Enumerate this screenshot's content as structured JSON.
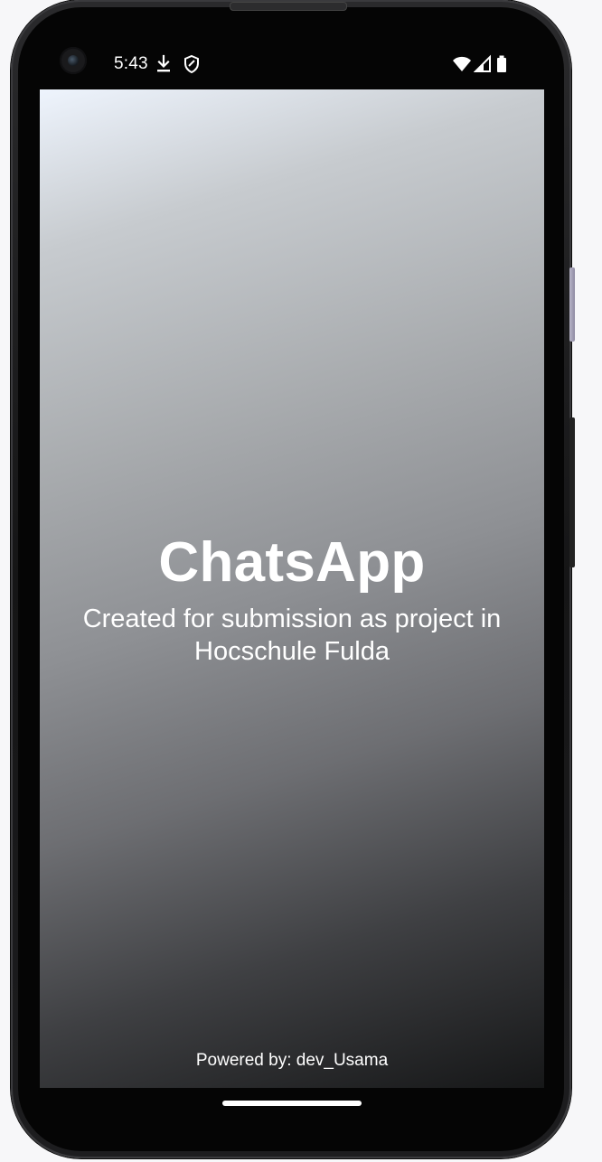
{
  "status_bar": {
    "time": "5:43",
    "icons": {
      "download": "download-icon",
      "shield": "shield-icon",
      "wifi": "wifi-icon",
      "signal": "signal-icon",
      "battery": "battery-icon"
    }
  },
  "splash": {
    "title": "ChatsApp",
    "subtitle": "Created for submission as project in Hocschule Fulda",
    "footer": "Powered by: dev_Usama"
  },
  "colors": {
    "text": "#ffffff",
    "gradient_start": "#eef4fd",
    "gradient_end": "#161718"
  }
}
